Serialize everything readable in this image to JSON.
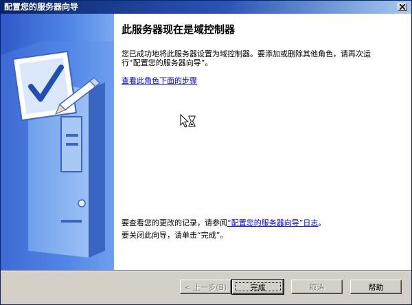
{
  "window": {
    "title": "配置您的服务器向导"
  },
  "main": {
    "heading": "此服务器现在是域控制器",
    "description": "您已成功地将此服务器设置为域控制器。要添加或删除其他角色，请再次运行“配置您的服务器向导”。",
    "steps_link": "查看此角色下面的步骤",
    "log_prefix": "要查看您的更改的记录，请参阅",
    "log_link": "“配置您的服务器向导”日志",
    "log_suffix": "。",
    "close_text": "要关闭此向导，请单击“完成”。"
  },
  "buttons": {
    "back": "< 上一步(B)",
    "finish": "完成",
    "cancel": "取消",
    "help": "帮助"
  },
  "icons": {
    "close": "close-icon",
    "illustration": "server-checklist-illustration",
    "cursor": "busy-cursor-icon"
  },
  "colors": {
    "title_start": "#0a246a",
    "title_end": "#a6caf0",
    "side_panel": "#3d6fd6",
    "link": "#0000ee"
  }
}
